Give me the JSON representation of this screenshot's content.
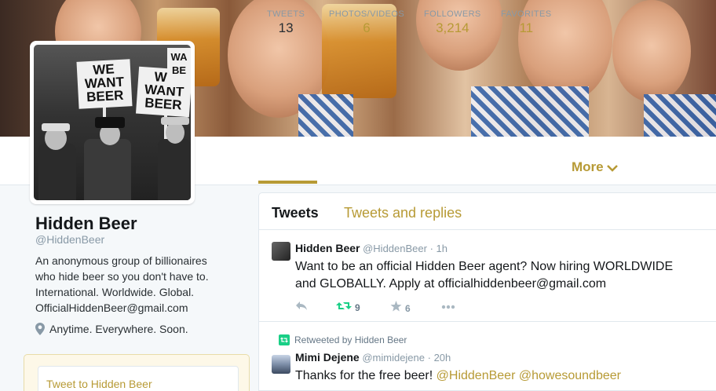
{
  "profile": {
    "name": "Hidden Beer",
    "handle": "@HiddenBeer",
    "bio": "An anonymous group of billionaires\nwho hide beer so you don't have to.\nInternational. Worldwide. Global.\nOfficialHiddenBeer@gmail.com",
    "location": "Anytime. Everywhere. Soon.",
    "avatar_signs": [
      "WE\nWANT\nBEER",
      "WE\nWANT\nBEER"
    ]
  },
  "stats": [
    {
      "label": "TWEETS",
      "value": "13"
    },
    {
      "label": "PHOTOS/VIDEOS",
      "value": "6"
    },
    {
      "label": "FOLLOWERS",
      "value": "3,214"
    },
    {
      "label": "FAVORITES",
      "value": "11"
    }
  ],
  "more_label": "More",
  "tweet_to": {
    "placeholder": "Tweet to Hidden Beer"
  },
  "timeline": {
    "tabs": [
      "Tweets",
      "Tweets and replies"
    ],
    "tweets": [
      {
        "name": "Hidden Beer",
        "handle": "@HiddenBeer",
        "time": "· 1h",
        "text": "Want to be an official Hidden Beer agent?  Now hiring WORLDWIDE\nand GLOBALLY.  Apply at officialhiddenbeer@gmail.com",
        "retweets": "9",
        "favorites": "6"
      },
      {
        "retweet_context": "Retweeted by Hidden Beer",
        "name": "Mimi Dejene",
        "handle": "@mimidejene",
        "time": "· 20h",
        "text_plain": "Thanks for the free beer! ",
        "mention1": "@HiddenBeer",
        "mention2": "@howesoundbeer"
      }
    ]
  },
  "colors": {
    "accent": "#b79a35",
    "retweet_green": "#19cf86",
    "muted": "#8899a6"
  }
}
